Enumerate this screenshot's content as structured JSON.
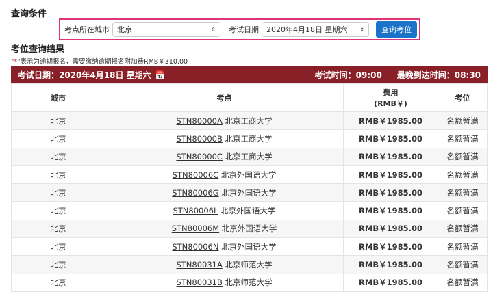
{
  "query": {
    "title": "查询条件",
    "city_label": "考点所在城市",
    "city_value": "北京",
    "date_label": "考试日期",
    "date_value": "2020年4月18日 星期六",
    "button": "查询考位"
  },
  "results": {
    "title": "考位查询结果",
    "note_star": "*",
    "note_pre": "\"",
    "note_post": "\"表示为逾期报名，需要缴纳逾期报名附加费RMB￥310.00",
    "bar": {
      "date": "考试日期：2020年4月18日 星期六",
      "exam_time": "考试时间：09:00",
      "latest_arrival": "最晚到达时间：08:30"
    },
    "headers": {
      "city": "城市",
      "site": "考点",
      "fee1": "费用",
      "fee2": "(RMB￥)",
      "seat": "考位"
    },
    "rows": [
      {
        "city": "北京",
        "code": "STN80000A",
        "name": "北京工商大学",
        "fee": "RMB￥1985.00",
        "seat": "名额暂满"
      },
      {
        "city": "北京",
        "code": "STN80000B",
        "name": "北京工商大学",
        "fee": "RMB￥1985.00",
        "seat": "名额暂满"
      },
      {
        "city": "北京",
        "code": "STN80000C",
        "name": "北京工商大学",
        "fee": "RMB￥1985.00",
        "seat": "名额暂满"
      },
      {
        "city": "北京",
        "code": "STN80006C",
        "name": "北京外国语大学",
        "fee": "RMB￥1985.00",
        "seat": "名额暂满"
      },
      {
        "city": "北京",
        "code": "STN80006G",
        "name": "北京外国语大学",
        "fee": "RMB￥1985.00",
        "seat": "名额暂满"
      },
      {
        "city": "北京",
        "code": "STN80006L",
        "name": "北京外国语大学",
        "fee": "RMB￥1985.00",
        "seat": "名额暂满"
      },
      {
        "city": "北京",
        "code": "STN80006M",
        "name": "北京外国语大学",
        "fee": "RMB￥1985.00",
        "seat": "名额暂满"
      },
      {
        "city": "北京",
        "code": "STN80006N",
        "name": "北京外国语大学",
        "fee": "RMB￥1985.00",
        "seat": "名额暂满"
      },
      {
        "city": "北京",
        "code": "STN80031A",
        "name": "北京师范大学",
        "fee": "RMB￥1985.00",
        "seat": "名额暂满"
      },
      {
        "city": "北京",
        "code": "STN80031B",
        "name": "北京师范大学",
        "fee": "RMB￥1985.00",
        "seat": "名额暂满"
      }
    ]
  }
}
